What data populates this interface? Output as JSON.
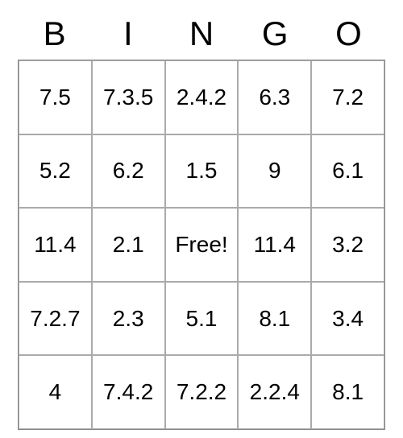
{
  "header": [
    "B",
    "I",
    "N",
    "G",
    "O"
  ],
  "grid": [
    [
      "7.5",
      "7.3.5",
      "2.4.2",
      "6.3",
      "7.2"
    ],
    [
      "5.2",
      "6.2",
      "1.5",
      "9",
      "6.1"
    ],
    [
      "11.4",
      "2.1",
      "Free!",
      "11.4",
      "3.2"
    ],
    [
      "7.2.7",
      "2.3",
      "5.1",
      "8.1",
      "3.4"
    ],
    [
      "4",
      "7.4.2",
      "7.2.2",
      "2.2.4",
      "8.1"
    ]
  ]
}
